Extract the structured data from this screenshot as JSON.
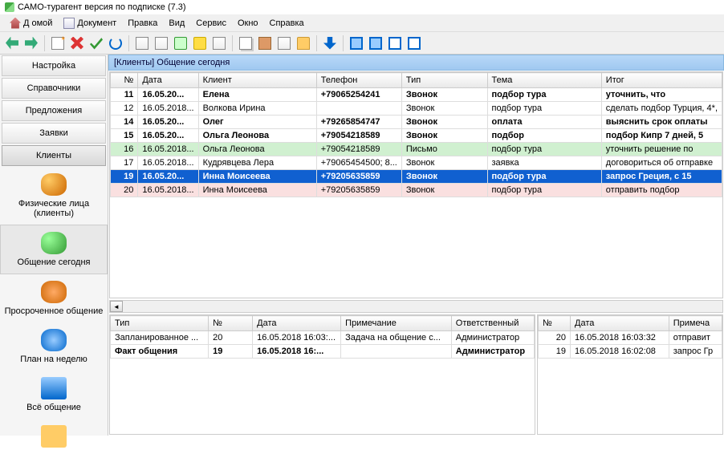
{
  "title": "САМО-турагент версия по подписке (7.3)",
  "menu": {
    "home": "Домой",
    "doc": "Документ",
    "edit": "Правка",
    "view": "Вид",
    "service": "Сервис",
    "window": "Окно",
    "help": "Справка"
  },
  "sidebar": {
    "buttons": [
      "Настройка",
      "Справочники",
      "Предложения",
      "Заявки",
      "Клиенты"
    ],
    "icons": [
      {
        "label": "Физические лица (клиенты)"
      },
      {
        "label": "Общение сегодня"
      },
      {
        "label": "Просроченное общение"
      },
      {
        "label": "План на неделю"
      },
      {
        "label": "Всё общение"
      }
    ]
  },
  "content_title": "[Клиенты] Общение сегодня",
  "grid": {
    "headers": [
      "№",
      "Дата",
      "Клиент",
      "Телефон",
      "Тип",
      "Тема",
      "Итог"
    ],
    "rows": [
      {
        "n": "11",
        "d": "16.05.20...",
        "c": "Елена",
        "p": "+79065254241",
        "t": "Звонок",
        "th": "подбор тура",
        "r": "уточнить, что",
        "cls": "bold"
      },
      {
        "n": "12",
        "d": "16.05.2018...",
        "c": "Волкова Ирина",
        "p": "",
        "t": "Звонок",
        "th": "подбор тура",
        "r": "сделать подбор Турция, 4*,",
        "cls": ""
      },
      {
        "n": "14",
        "d": "16.05.20...",
        "c": "Олег",
        "p": "+79265854747",
        "t": "Звонок",
        "th": "оплата",
        "r": "выяснить срок оплаты",
        "cls": "bold"
      },
      {
        "n": "15",
        "d": "16.05.20...",
        "c": "Ольга Леонова",
        "p": "+79054218589",
        "t": "Звонок",
        "th": "подбор",
        "r": "подбор Кипр 7 дней, 5",
        "cls": "bold"
      },
      {
        "n": "16",
        "d": "16.05.2018...",
        "c": "Ольга Леонова",
        "p": "+79054218589",
        "t": "Письмо",
        "th": "подбор тура",
        "r": "уточнить решение по",
        "cls": "green"
      },
      {
        "n": "17",
        "d": "16.05.2018...",
        "c": "Кудрявцева Лера",
        "p": "+79065454500; 8...",
        "t": "Звонок",
        "th": "заявка",
        "r": "договориться об отправке",
        "cls": ""
      },
      {
        "n": "19",
        "d": "16.05.20...",
        "c": "Инна Моисеева",
        "p": "+79205635859",
        "t": "Звонок",
        "th": "подбор тура",
        "r": "запрос Греция, с 15",
        "cls": "sel bold"
      },
      {
        "n": "20",
        "d": "16.05.2018...",
        "c": "Инна Моисеева",
        "p": "+79205635859",
        "t": "Звонок",
        "th": "подбор тура",
        "r": "отправить подбор",
        "cls": "pink"
      }
    ]
  },
  "bottom1": {
    "headers": [
      "Тип",
      "№",
      "Дата",
      "Примечание",
      "Ответственный"
    ],
    "rows": [
      {
        "t": "Запланированное ...",
        "n": "20",
        "d": "16.05.2018 16:03:...",
        "p": "Задача на общение с...",
        "r": "Администратор",
        "cls": ""
      },
      {
        "t": "Факт общения",
        "n": "19",
        "d": "16.05.2018 16:...",
        "p": "",
        "r": "Администратор",
        "cls": "bold"
      }
    ]
  },
  "bottom2": {
    "headers": [
      "№",
      "Дата",
      "Примеча"
    ],
    "rows": [
      {
        "n": "20",
        "d": "16.05.2018 16:03:32",
        "p": "отправит",
        "cls": ""
      },
      {
        "n": "19",
        "d": "16.05.2018 16:02:08",
        "p": "запрос Гр",
        "cls": ""
      }
    ]
  }
}
